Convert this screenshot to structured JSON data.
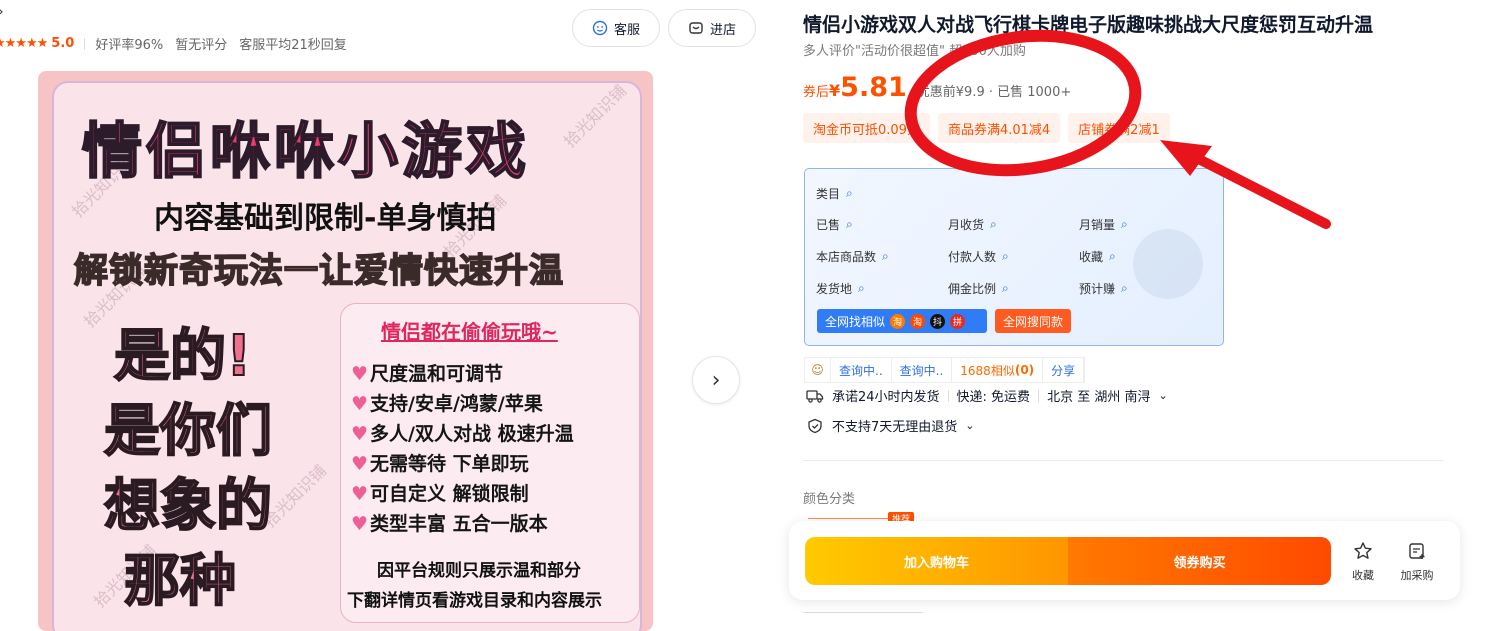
{
  "header": {
    "back_glyph": "›",
    "rating": {
      "stars": "★★★★★",
      "score": "5.0",
      "good_rate": "好评率96%",
      "no_score": "暂无评分",
      "service_reply": "客服平均21秒回复"
    },
    "service_button": "客服",
    "shop_button": "进店"
  },
  "gallery": {
    "image": {
      "title": "情侣咻咻小游戏",
      "line2": "内容基础到限制-单身慎拍",
      "line3": "解锁新奇玩法一让爱情快速升温",
      "big_lines": [
        "是的!",
        "是你们",
        "想象的",
        "那种"
      ],
      "box_title": "情侣都在偷偷玩哦~",
      "features": [
        "尺度温和可调节",
        "支持/安卓/鸿蒙/苹果",
        "多人/双人对战 极速升温",
        "无需等待 下单即玩",
        "可自定义 解锁限制",
        "类型丰富 五合一版本"
      ],
      "footer": [
        "因平台规则只展示温和部分",
        "下翻详情页看游戏目录和内容展示"
      ],
      "watermark": "拾光知识铺"
    },
    "next_glyph": "›"
  },
  "product": {
    "title": "情侣小游戏双人对战飞行棋卡牌电子版趣味挑战大尺度惩罚互动升温",
    "subtitle": "多人评价\"活动价很超值\" 超100人加购",
    "coupon_label": "券后",
    "currency": "¥",
    "price": "5.81",
    "original_and_sold": "优惠前¥9.9 · 已售 1000+",
    "tags": [
      "淘金币可抵0.09元",
      "商品券满4.01减4",
      "店铺券满2减1"
    ]
  },
  "stats_panel": {
    "category_label": "类目",
    "items": [
      [
        "已售",
        "月收货",
        "月销量"
      ],
      [
        "本店商品数",
        "付款人数",
        "收藏"
      ],
      [
        "发货地",
        "佣金比例",
        "预计赚"
      ]
    ],
    "find_similar": "全网找相似",
    "find_similar_icons": [
      "淘",
      "抖",
      "拼"
    ],
    "search_same": "全网搜同款"
  },
  "tools": {
    "query1": "查询中..",
    "query2": "查询中..",
    "similar_1688": "1688相似",
    "similar_count": "(0)",
    "share": "分享"
  },
  "shipping": {
    "promise": "承诺24小时内发货",
    "express": "快递: 免运费",
    "route": "北京 至 湖州 南浔"
  },
  "returns": {
    "text": "不支持7天无理由退货"
  },
  "color_section": {
    "label": "颜色分类",
    "badge": "推荐"
  },
  "buybar": {
    "add_cart": "加入购物车",
    "buy_now": "领券购买",
    "favorite": "收藏",
    "add_purchase": "加采购"
  },
  "colors": {
    "accent": "#ff5000",
    "annotation_red": "#e8141c",
    "panel_blue": "#2f7cf6"
  }
}
